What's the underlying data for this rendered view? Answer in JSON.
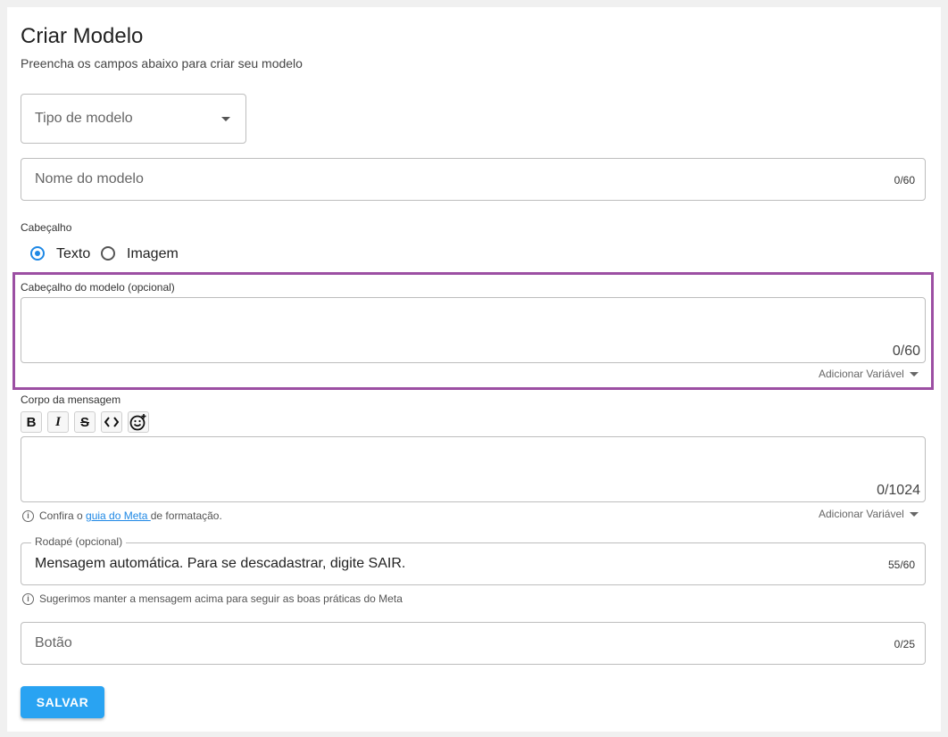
{
  "header": {
    "title": "Criar Modelo",
    "subtitle": "Preencha os campos abaixo para criar seu modelo"
  },
  "template_type": {
    "placeholder": "Tipo de modelo"
  },
  "template_name": {
    "placeholder": "Nome do modelo",
    "counter": "0/60"
  },
  "header_section": {
    "label": "Cabeçalho",
    "options": [
      {
        "label": "Texto",
        "selected": true
      },
      {
        "label": "Imagem",
        "selected": false
      }
    ],
    "field_label": "Cabeçalho do modelo (opcional)",
    "counter": "0/60",
    "add_variable": "Adicionar Variável"
  },
  "body_section": {
    "label": "Corpo da mensagem",
    "toolbar": [
      "bold-icon",
      "italic-icon",
      "strikethrough-icon",
      "code-icon",
      "emoji-add-icon"
    ],
    "counter": "0/1024",
    "info_prefix": "Confira o ",
    "info_link": "guia do Meta ",
    "info_suffix": "de formatação.",
    "add_variable": "Adicionar Variável"
  },
  "footer_section": {
    "label": "Rodapé (opcional)",
    "value": "Mensagem automática. Para se descadastrar, digite SAIR.",
    "counter": "55/60",
    "info": "Sugerimos manter a mensagem acima para seguir as boas práticas do Meta"
  },
  "button_field": {
    "placeholder": "Botão",
    "counter": "0/25"
  },
  "save_button": {
    "label": "SALVAR"
  },
  "colors": {
    "accent": "#1e88e5",
    "save_button": "#29a3f2",
    "highlight_border": "#9c4fa3"
  }
}
